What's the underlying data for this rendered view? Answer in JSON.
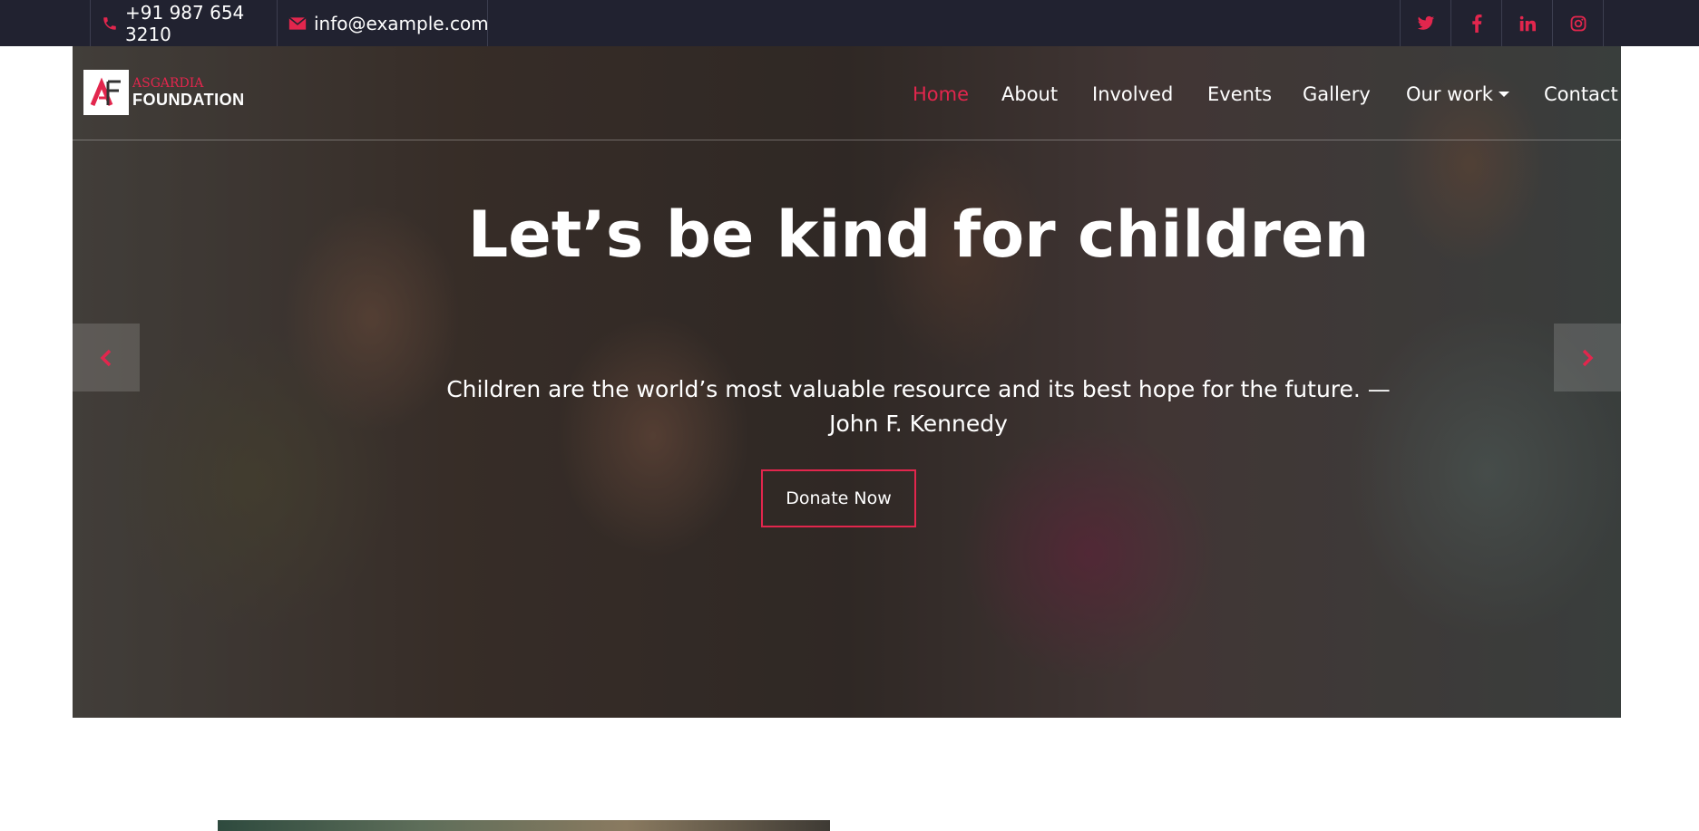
{
  "topbar": {
    "phone": "+91 987 654 3210",
    "email": "info@example.com",
    "phone_icon": "phone-icon",
    "email_icon": "envelope-icon",
    "social": [
      "twitter-icon",
      "facebook-icon",
      "linkedin-icon",
      "instagram-icon"
    ]
  },
  "logo": {
    "top_text": "ASGARDIA",
    "bottom_text": "FOUNDATION"
  },
  "nav": {
    "items": [
      {
        "label": "Home",
        "active": true
      },
      {
        "label": "About"
      },
      {
        "label": "Involved"
      },
      {
        "label": "Events"
      },
      {
        "label": "Gallery"
      },
      {
        "label": "Our work",
        "dropdown": true
      },
      {
        "label": "Contact"
      }
    ]
  },
  "hero": {
    "title": "Let’s be kind for children",
    "subtitle": "Children are the world’s most valuable resource and its best hope for the future. — John F. Kennedy",
    "button": "Donate Now",
    "prev_icon": "chevron-left-icon",
    "next_icon": "chevron-right-icon"
  },
  "colors": {
    "accent": "#e2264d",
    "topbar_bg": "#212230"
  }
}
